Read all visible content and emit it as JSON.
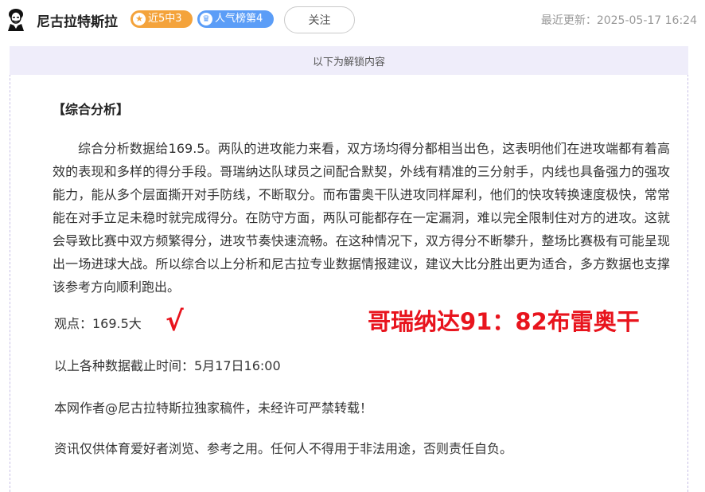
{
  "header": {
    "author": "尼古拉特斯拉",
    "badge_streak": "近5中3",
    "badge_rank": "人气榜第4",
    "follow_label": "关注",
    "updated": "最近更新：2025-05-17 16:24"
  },
  "unlock_notice": "以下为解锁内容",
  "article": {
    "section_title": "【综合分析】",
    "paragraph": "综合分析数据给169.5。两队的进攻能力来看，双方场均得分都相当出色，这表明他们在进攻端都有着高效的表现和多样的得分手段。哥瑞纳达队球员之间配合默契，外线有精准的三分射手，内线也具备强力的强攻能力，能从多个层面撕开对手防线，不断取分。而布雷奥干队进攻同样犀利，他们的快攻转换速度极快，常常能在对手立足未稳时就完成得分。在防守方面，两队可能都存在一定漏洞，难以完全限制住对方的进攻。这就会导致比赛中双方频繁得分，进攻节奏快速流畅。在这种情况下，双方得分不断攀升，整场比赛极有可能呈现出一场进球大战。所以综合以上分析和尼古拉专业数据情报建议，建议大比分胜出更为适合，多方数据也支撑该参考方向顺利跑出。",
    "view": "观点：169.5大",
    "check_mark": "√",
    "score_result": "哥瑞纳达91：82布雷奥干",
    "cutoff": "以上各种数据截止时间：5月17日16:00",
    "copyright": "本网作者@尼古拉特斯拉独家稿件，未经许可严禁转载！",
    "disclaimer": "资讯仅供体育爱好者浏览、参考之用。任何人不得用于非法用途，否则责任自负。"
  },
  "colors": {
    "accent_red": "#e8141d",
    "badge_orange": "#f4a33b",
    "badge_blue": "#5b9df7",
    "unlock_bg": "#efedfa"
  },
  "icons": {
    "avatar": "tesla-portrait-icon",
    "streak": "star-icon",
    "rank": "crown-icon"
  }
}
